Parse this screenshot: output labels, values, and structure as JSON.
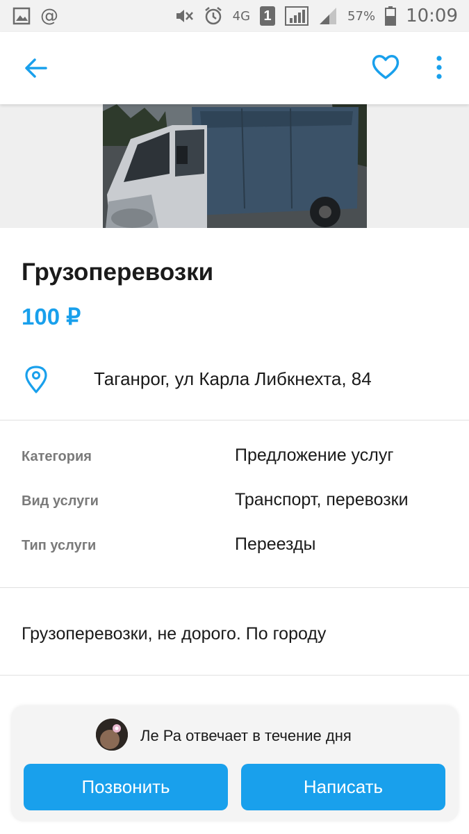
{
  "status_bar": {
    "network": "4G",
    "sim": "1",
    "battery": "57%",
    "time": "10:09",
    "icons": [
      "gallery-icon",
      "at-icon",
      "mute-icon",
      "alarm-icon",
      "signal-icon",
      "battery-icon"
    ]
  },
  "app_bar": {
    "icons": [
      "back-arrow-icon",
      "heart-icon",
      "more-vert-icon"
    ]
  },
  "listing": {
    "title": "Грузоперевозки",
    "price": "100 ₽",
    "address": "Таганрог, ул Карла Либкнехта, 84",
    "params": [
      {
        "key": "Категория",
        "value": "Предложение услуг"
      },
      {
        "key": "Вид услуги",
        "value": "Транспорт, перевозки"
      },
      {
        "key": "Тип услуги",
        "value": "Переезды"
      }
    ],
    "description": "Грузоперевозки, не дорого. По городу"
  },
  "seller": {
    "reply_text": "Ле Ра отвечает в течение дня"
  },
  "actions": {
    "call_label": "Позвонить",
    "write_label": "Написать"
  },
  "colors": {
    "accent": "#19a0ec",
    "text": "#1a1a1a",
    "muted": "#7a7a7a"
  }
}
